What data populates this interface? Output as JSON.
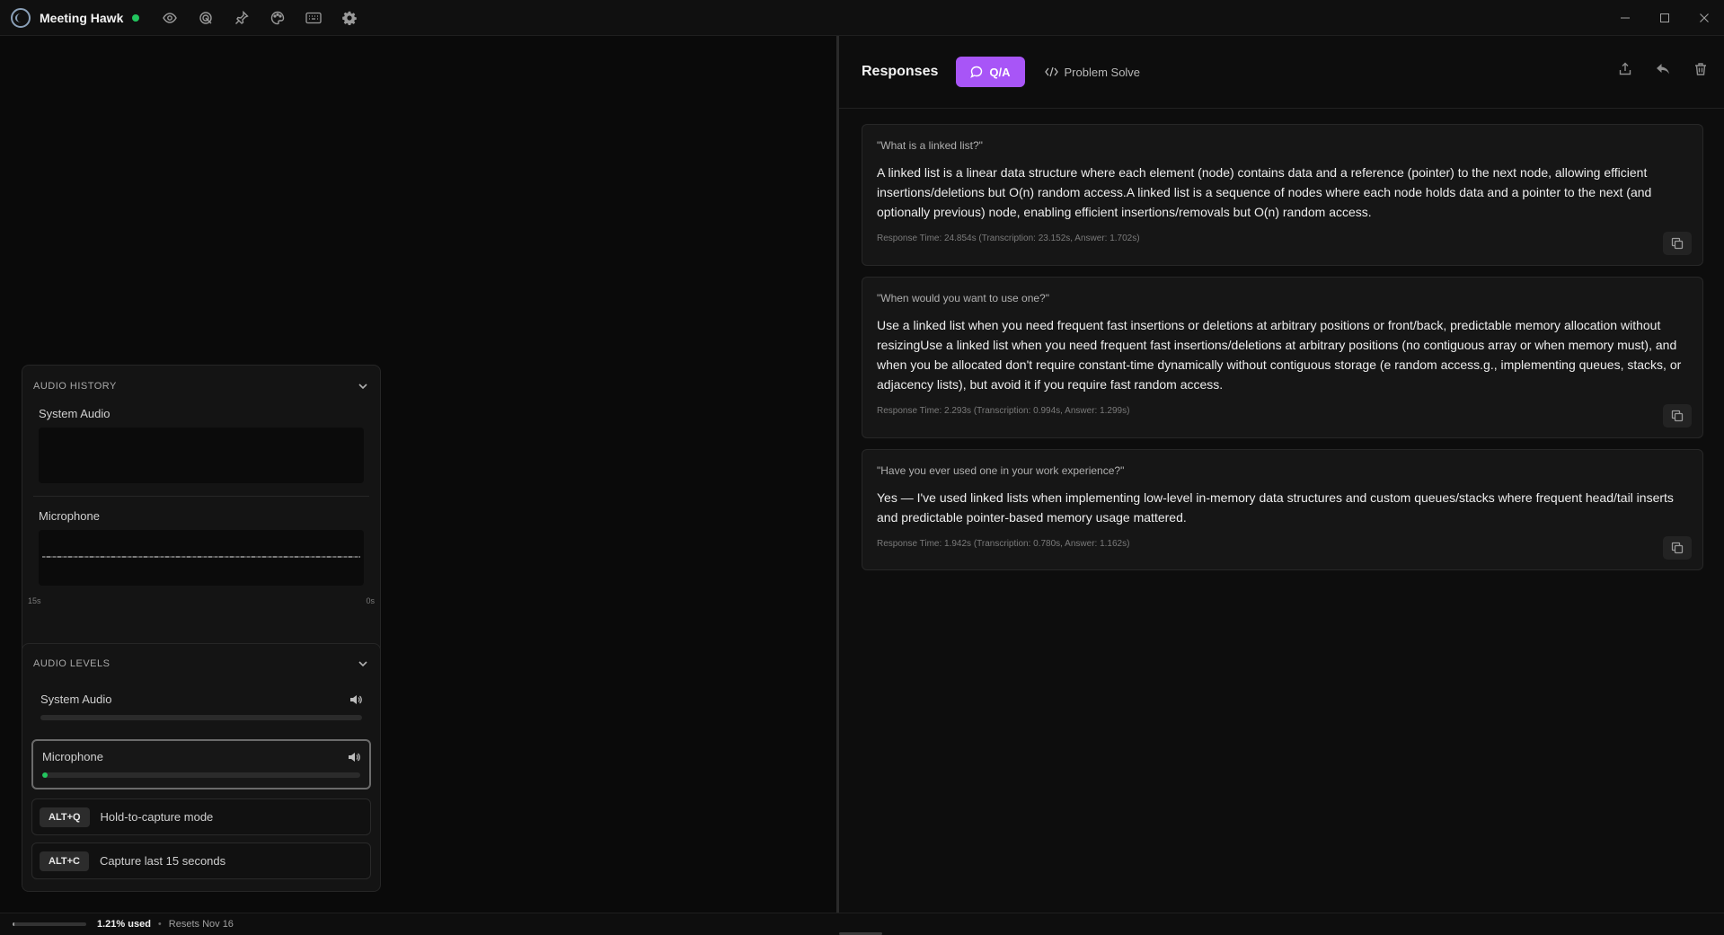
{
  "app": {
    "title": "Meeting Hawk",
    "status_color": "#22c55e",
    "toolbar_icons": [
      "eye-icon",
      "target-icon",
      "pin-icon",
      "palette-icon",
      "keyboard-icon",
      "gear-icon"
    ],
    "window_controls": [
      "minimize",
      "maximize",
      "close"
    ]
  },
  "audio_history": {
    "title": "AUDIO HISTORY",
    "system_label": "System Audio",
    "mic_label": "Microphone",
    "time_start": "15s",
    "time_end": "0s"
  },
  "audio_levels": {
    "title": "AUDIO LEVELS",
    "system_label": "System Audio",
    "system_level": 0,
    "mic_label": "Microphone",
    "mic_level": 0.02
  },
  "shortcuts": [
    {
      "key": "ALT+Q",
      "label": "Hold-to-capture mode"
    },
    {
      "key": "ALT+C",
      "label": "Capture last 15 seconds"
    }
  ],
  "usage": {
    "used_text": "1.21% used",
    "used_fraction": 0.0121,
    "separator": "•",
    "reset_text": "Resets Nov 16"
  },
  "responses": {
    "title": "Responses",
    "tab_qa": "Q/A",
    "tab_problem": "Problem Solve",
    "accent": "#a855f7",
    "items": [
      {
        "question": "\"What is a linked list?\"",
        "answer": "A linked list is a linear data structure where each element (node) contains data and a reference (pointer) to the next node, allowing efficient insertions/deletions but O(n) random access.A linked list is a sequence of nodes where each node holds data and a pointer to the next (and optionally previous) node, enabling efficient insertions/removals but O(n) random access.",
        "meta": "Response Time: 24.854s (Transcription: 23.152s, Answer: 1.702s)"
      },
      {
        "question": "\"When would you want to use one?\"",
        "answer": "Use a linked list when you need frequent fast insertions or deletions at arbitrary positions or front/back, predictable memory allocation without resizingUse a linked list when you need frequent fast insertions/deletions at arbitrary positions (no contiguous array or when memory must), and when you be allocated don't require constant-time dynamically without contiguous storage (e random access.g., implementing queues, stacks, or adjacency lists), but avoid it if you require fast random access.",
        "meta": "Response Time: 2.293s (Transcription: 0.994s, Answer: 1.299s)"
      },
      {
        "question": "\"Have you ever used one in your work experience?\"",
        "answer": "Yes — I've used linked lists when implementing low-level in-memory data structures and custom queues/stacks where frequent head/tail inserts and predictable pointer-based memory usage mattered.",
        "meta": "Response Time: 1.942s (Transcription: 0.780s, Answer: 1.162s)"
      }
    ]
  }
}
